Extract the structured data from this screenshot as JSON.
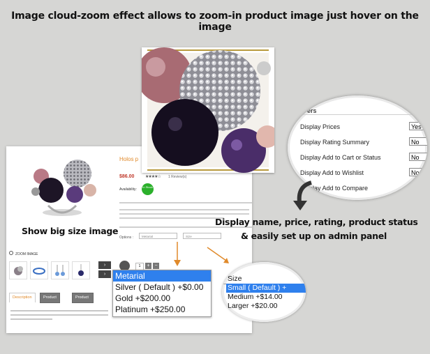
{
  "headline": "Image cloud-zoom  effect allows to zoom-in product image just hover on the image",
  "left_caption": "Show big size image",
  "right_caption": {
    "line1": "Display name, price, rating, product status",
    "line2": "& easily set up on admin panel"
  },
  "product": {
    "title": "Holos p",
    "price": "$86.00",
    "stars": "★★★★☆",
    "reviews": "1 Review(s)",
    "availability_label": "Availability:",
    "stock_badge": "In Stock",
    "options_label": "Options :",
    "option1_placeholder": "Metarial",
    "option2_placeholder": "Size",
    "qty": "1",
    "plus": "+",
    "minus": "−",
    "zoom_label": "ZOOM IMAGE",
    "prev": "‹",
    "next": "›"
  },
  "tabs": [
    "Description",
    "Product Tags",
    "Product Reviews"
  ],
  "admin": {
    "heading": "ers",
    "rows": [
      {
        "label": "Display Prices",
        "value": "Yes"
      },
      {
        "label": "Display Rating Summary",
        "value": "No"
      },
      {
        "label": "Display Add to Cart or Status",
        "value": "No"
      },
      {
        "label": "Display Add to Wishlist",
        "value": "No"
      },
      {
        "label": "Display Add to Compare",
        "value": ""
      }
    ]
  },
  "material_options": [
    {
      "label": "Metarial",
      "selected": true
    },
    {
      "label": "Silver ( Default ) +$0.00",
      "selected": false
    },
    {
      "label": "Gold +$200.00",
      "selected": false
    },
    {
      "label": "Platinum +$250.00",
      "selected": false
    }
  ],
  "size_options": [
    {
      "label": "Size",
      "selected": false
    },
    {
      "label": "Small ( Default ) +",
      "selected": true
    },
    {
      "label": "Medium +$14.00",
      "selected": false
    },
    {
      "label": "Larger +$20.00",
      "selected": false
    }
  ],
  "colors": {
    "accent_orange": "#e08a2b",
    "select_blue": "#2f80ed",
    "price_red": "#c0392b",
    "stock_green": "#2bb02b"
  }
}
